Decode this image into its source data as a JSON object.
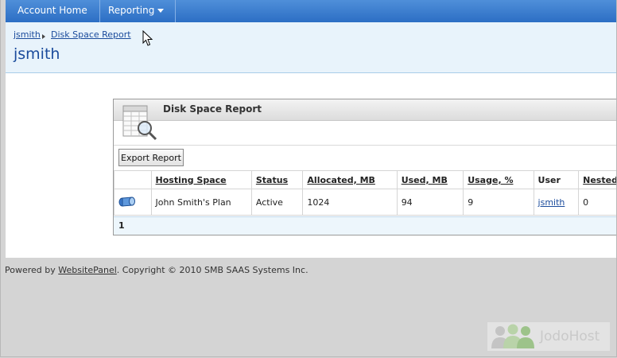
{
  "nav": {
    "items": [
      {
        "label": "Account Home"
      },
      {
        "label": "Reporting"
      }
    ]
  },
  "breadcrumb": {
    "items": [
      {
        "label": "jsmith"
      },
      {
        "label": "Disk Space Report"
      }
    ]
  },
  "page": {
    "title": "jsmith"
  },
  "panel": {
    "title": "Disk Space Report",
    "export_label": "Export Report"
  },
  "table": {
    "columns": [
      "Hosting Space",
      "Status",
      "Allocated, MB",
      "Used, MB",
      "Usage, %",
      "User",
      "Nested"
    ],
    "rows": [
      {
        "hosting_space": "John Smith's Plan",
        "status": "Active",
        "allocated": "1024",
        "used": "94",
        "usage": "9",
        "user": "jsmith",
        "nested": "0"
      }
    ],
    "pager": "1"
  },
  "footer": {
    "prefix": "Powered by ",
    "link": "WebsitePanel",
    "suffix": ". Copyright © 2010 SMB SAAS Systems Inc."
  },
  "watermark": {
    "text": "JodoHost"
  },
  "icons": {
    "nav_dropdown": "chevron-down-icon",
    "breadcrumb_separator": "triangle-right-icon",
    "report": "report-magnifier-icon",
    "row": "hosting-space-icon",
    "cursor": "mouse-pointer-icon"
  },
  "colors": {
    "nav_bar": "#2c6ec4",
    "header_band": "#e8f3fb",
    "link": "#1a4b9c"
  }
}
